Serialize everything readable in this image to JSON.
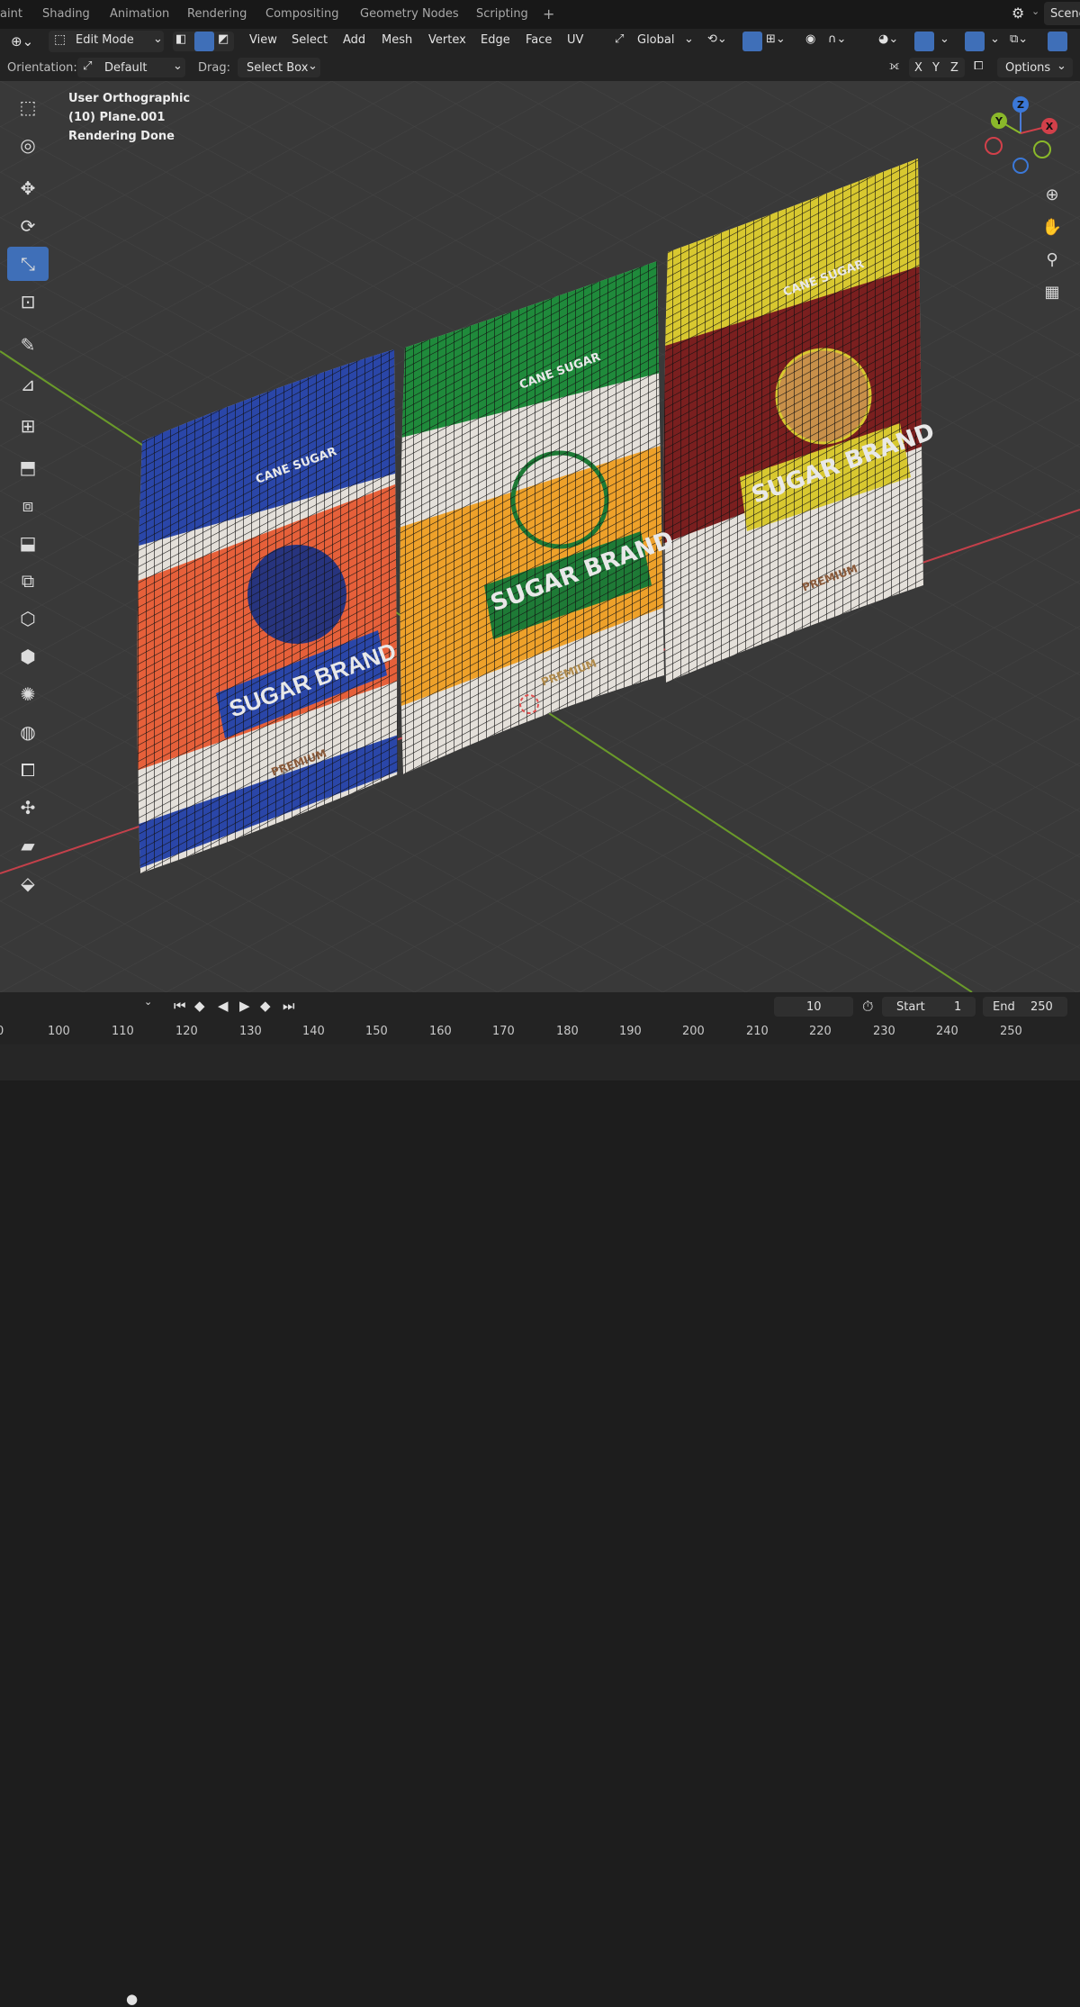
{
  "workspace_tabs": [
    "aint",
    "Shading",
    "Animation",
    "Rendering",
    "Compositing",
    "Geometry Nodes",
    "Scripting",
    "+"
  ],
  "scene_label": "Scene",
  "header": {
    "mode": "Edit Mode",
    "menus": [
      "View",
      "Select",
      "Add",
      "Mesh",
      "Vertex",
      "Edge",
      "Face",
      "UV"
    ],
    "transform_orientation": "Global"
  },
  "header2": {
    "orientation_label": "Orientation:",
    "orientation_value": "Default",
    "drag_label": "Drag:",
    "drag_value": "Select Box",
    "axes": [
      "X",
      "Y",
      "Z"
    ],
    "options_label": "Options"
  },
  "overlay": {
    "view_name": "User Orthographic",
    "object_info": "(10) Plane.001",
    "render_status": "Rendering Done"
  },
  "gizmo": {
    "x": "X",
    "y": "Y",
    "z": "Z"
  },
  "bags": [
    {
      "top_color": "#2a46a8",
      "mid_color": "#e6603a",
      "bottom_color": "#e4e0da",
      "label": "SUGAR BRAND",
      "sub": "CANE SUGAR",
      "tag": "PREMIUM",
      "accent": "#27347e"
    },
    {
      "top_color": "#1f8a3b",
      "mid_color": "#eea12a",
      "bottom_color": "#e4e0da",
      "label": "SUGAR BRAND",
      "sub": "CANE SUGAR",
      "tag": "PREMIUM",
      "accent": "#1e7a36"
    },
    {
      "top_color": "#d8c830",
      "mid_color": "#7a1f1f",
      "bottom_color": "#e4e0da",
      "label": "SUGAR BRAND",
      "sub": "CANE SUGAR",
      "tag": "PREMIUM",
      "accent": "#d8c830"
    }
  ],
  "timeline": {
    "current_frame": "10",
    "start_label": "Start",
    "start_value": "1",
    "end_label": "End",
    "end_value": "250",
    "ticks": [
      "0",
      "100",
      "110",
      "120",
      "130",
      "140",
      "150",
      "160",
      "170",
      "180",
      "190",
      "200",
      "210",
      "220",
      "230",
      "240",
      "250"
    ]
  },
  "colors": {
    "accent": "#3f6fb8",
    "x_axis": "#c4404a",
    "y_axis": "#6a9a2a"
  }
}
